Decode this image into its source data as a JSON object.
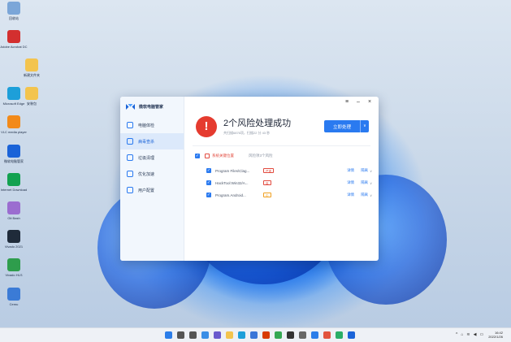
{
  "desktop": {
    "icons": [
      {
        "label": "回收站",
        "icon": "recycle-bin-icon",
        "color": "#7ba6d8"
      },
      {
        "label": "Adobe Acrobat DC",
        "icon": "acrobat-icon",
        "color": "#d32f2f"
      },
      {
        "label": "新建文件夹",
        "icon": "folder-icon",
        "color": "#f3c44e"
      },
      {
        "label": "Microsoft Edge",
        "icon": "edge-icon",
        "color": "#1d9fd9"
      },
      {
        "label": "安装包",
        "icon": "folder-icon",
        "color": "#f3c44e"
      },
      {
        "label": "VLC media player",
        "icon": "vlc-icon",
        "color": "#f28a1a"
      },
      {
        "label": "微软电脑管家",
        "icon": "pc-manager-icon",
        "color": "#1a63d8"
      },
      {
        "label": "Internet Download",
        "icon": "download-icon",
        "color": "#12a150"
      },
      {
        "label": "Git Bash",
        "icon": "git-bash-icon",
        "color": "#9b6dd0"
      },
      {
        "label": "Vivado 2021",
        "icon": "vivado-icon",
        "color": "#1f2b3a"
      },
      {
        "label": "Vivado HLS",
        "icon": "hls-icon",
        "color": "#2e9d4c"
      },
      {
        "label": "Cemu",
        "icon": "app-icon",
        "color": "#3b7bd6"
      }
    ]
  },
  "app": {
    "name": "微软电脑管家",
    "nav": [
      {
        "label": "电脑体检",
        "icon": "monitor-icon"
      },
      {
        "label": "病毒查杀",
        "icon": "shield-icon",
        "active": true
      },
      {
        "label": "垃圾清理",
        "icon": "broom-icon"
      },
      {
        "label": "优化加速",
        "icon": "rocket-icon"
      },
      {
        "label": "用户配置",
        "icon": "settings-icon"
      }
    ],
    "window_controls": {
      "menu": "≡",
      "minimize": "–",
      "close": "×"
    },
    "status": {
      "alert_glyph": "!",
      "title": "2个风险处理成功",
      "subtitle": "共扫描6876项，扫描22 分 43 秒"
    },
    "primary_button": {
      "label": "立即处理",
      "arrow": "∨"
    },
    "group": {
      "label": "系统关键位置",
      "count_text": "风险项3个风险"
    },
    "risks": [
      {
        "name": "Program Files\\Clag...",
        "badge": "严重",
        "badge_color": "#e24b3f"
      },
      {
        "name": "HackTool:Win32/A...",
        "badge": "高",
        "badge_color": "#e24b3f"
      },
      {
        "name": "Program.Android...",
        "badge": "中",
        "badge_color": "#f0a020"
      }
    ],
    "risk_actions": {
      "detail": "详情",
      "handle": "隔离"
    },
    "accent_color": "#2a7af0",
    "danger_color": "#e53b2f"
  },
  "taskbar": {
    "icons": [
      "start-icon",
      "search-icon",
      "taskview-icon",
      "widgets-icon",
      "chat-icon",
      "explorer-icon",
      "edge-icon",
      "store-icon",
      "office-icon",
      "chrome-icon",
      "terminal-icon",
      "settings-icon",
      "photos-icon",
      "paint-icon",
      "wechat-icon",
      "pc-manager-icon"
    ],
    "tray_glyphs": [
      "^",
      "⌂",
      "≋",
      "◀",
      "▭"
    ],
    "time": "16:42",
    "date": "2022/1/26"
  }
}
